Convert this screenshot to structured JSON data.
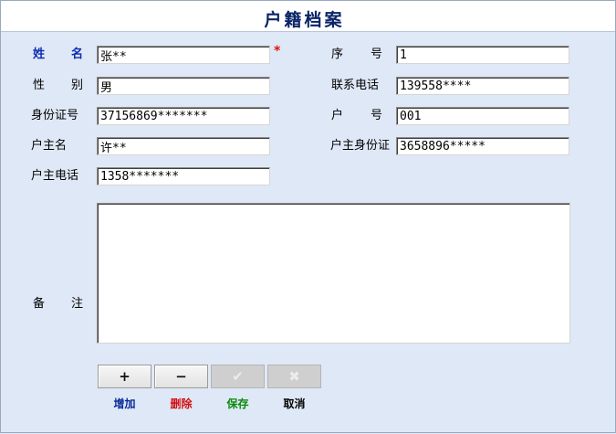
{
  "window": {
    "title": "户籍档案"
  },
  "form": {
    "name": {
      "label_chars": [
        "姓",
        "名"
      ],
      "value": "张**",
      "required_mark": "*"
    },
    "gender": {
      "label_chars": [
        "性",
        "别"
      ],
      "value": "男"
    },
    "id_card": {
      "label": "身份证号",
      "value": "37156869*******"
    },
    "householder": {
      "label": "户主名",
      "value": "许**"
    },
    "householder_tel": {
      "label": "户主电话",
      "value": "1358*******"
    },
    "serial_no": {
      "label_chars": [
        "序",
        "号"
      ],
      "value": "1"
    },
    "phone": {
      "label": "联系电话",
      "value": "139558****"
    },
    "household_no": {
      "label_chars": [
        "户",
        "号"
      ],
      "value": "001"
    },
    "householder_id": {
      "label": "户主身份证",
      "value": "3658896*****"
    },
    "remarks": {
      "label_chars": [
        "备",
        "注"
      ],
      "value": ""
    }
  },
  "toolbar": {
    "add": {
      "glyph": "+",
      "caption": "增加",
      "caption_color": "#0a2a9a"
    },
    "delete": {
      "glyph": "−",
      "caption": "删除",
      "caption_color": "#d01010"
    },
    "save": {
      "glyph": "✔",
      "caption": "保存",
      "caption_color": "#0a8a0a",
      "enabled": false
    },
    "cancel": {
      "glyph": "✖",
      "caption": "取消",
      "caption_color": "#000000",
      "enabled": false
    }
  }
}
